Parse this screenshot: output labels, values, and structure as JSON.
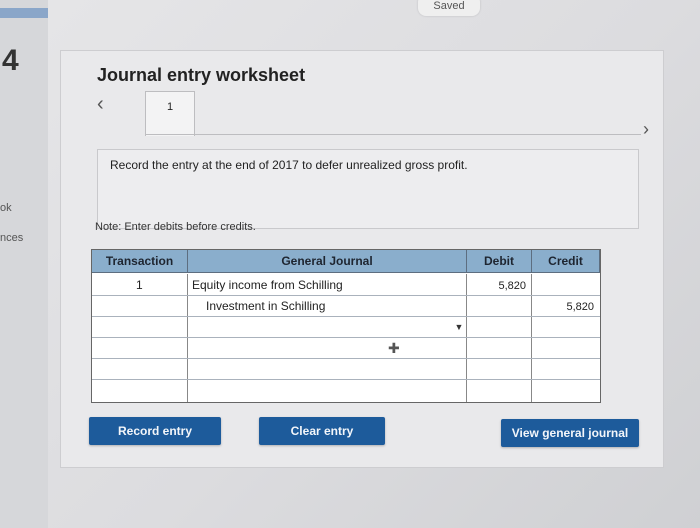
{
  "window": {
    "saved_status": "Saved"
  },
  "side": {
    "mark": "4",
    "text_1": "ok",
    "text_2": "nces"
  },
  "worksheet": {
    "title": "Journal entry worksheet",
    "prev_icon": "chevron-left-icon",
    "next_icon": "chevron-right-icon",
    "tabs": [
      {
        "label": "1"
      }
    ],
    "instruction": "Record the entry at the end of 2017 to defer unrealized gross profit.",
    "note": "Note: Enter debits before credits."
  },
  "table": {
    "headers": {
      "transaction": "Transaction",
      "general_journal": "General Journal",
      "debit": "Debit",
      "credit": "Credit"
    },
    "rows": [
      {
        "transaction": "1",
        "account": "Equity income from Schilling",
        "debit": "5,820",
        "credit": ""
      },
      {
        "transaction": "",
        "account": "Investment in Schilling",
        "debit": "",
        "credit": "5,820"
      }
    ]
  },
  "buttons": {
    "record_entry": "Record entry",
    "clear_entry": "Clear entry",
    "view_general_journal": "View general journal"
  },
  "colors": {
    "header_blue": "#8aaecc",
    "button_blue": "#1d5b9b"
  }
}
